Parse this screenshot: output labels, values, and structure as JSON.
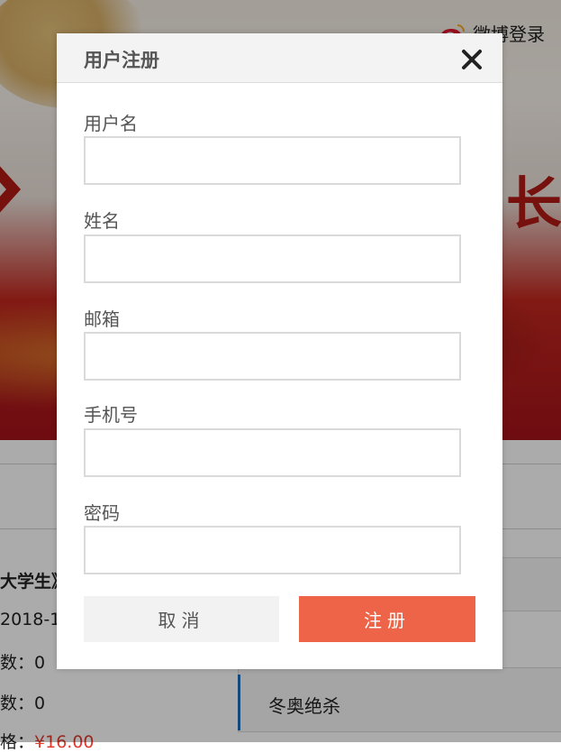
{
  "header": {
    "weibo_login_label": "微博登录"
  },
  "background": {
    "banner_char": "长",
    "book_title_fragment": "大学生》",
    "date_fragment": "2018-1",
    "stat_1": "数：0",
    "stat_2": "数：0",
    "price_prefix": "格：",
    "price_value": "¥16.00",
    "list_item_label": "冬奥绝杀"
  },
  "dialog": {
    "title": "用户注册",
    "fields": [
      {
        "label": "用户名",
        "value": "",
        "placeholder": ""
      },
      {
        "label": "姓名",
        "value": "",
        "placeholder": ""
      },
      {
        "label": "邮箱",
        "value": "",
        "placeholder": ""
      },
      {
        "label": "手机号",
        "value": "",
        "placeholder": ""
      },
      {
        "label": "密码",
        "value": "",
        "placeholder": ""
      }
    ],
    "cancel_label": "取消",
    "register_label": "注册"
  },
  "colors": {
    "accent": "#ee6448",
    "overlay": "rgba(0,0,0,0.33)",
    "banner_red": "#b11a16",
    "price_red": "#e23b2d",
    "list_bar_blue": "#1d6fb8"
  },
  "icons": {
    "close": "close-icon",
    "weibo": "weibo-icon",
    "logo": "chevron-logo-icon"
  }
}
